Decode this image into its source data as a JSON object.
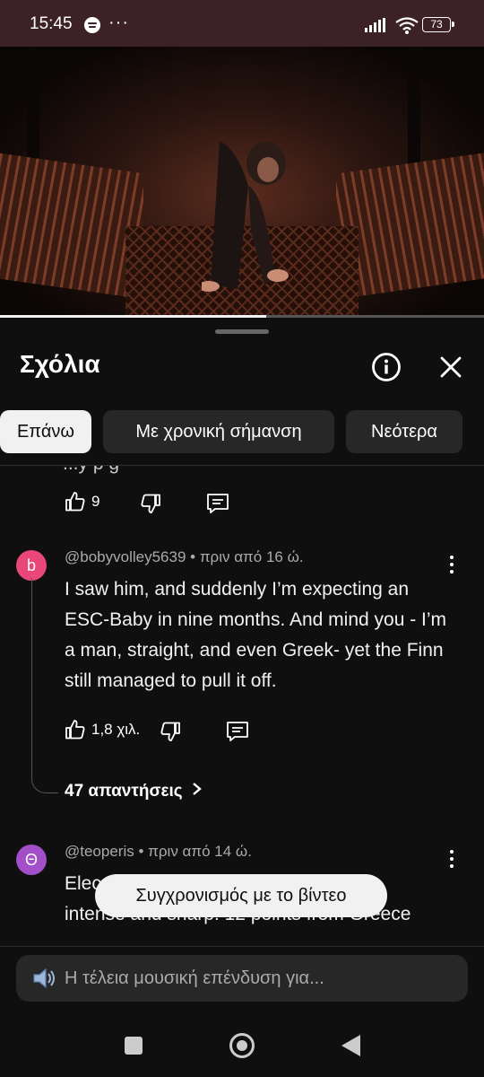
{
  "status_bar": {
    "time": "15:45",
    "notification_dots": "···",
    "battery": "73"
  },
  "video": {
    "progress": 0.55
  },
  "comments_panel": {
    "title": "Σχόλια",
    "chips": [
      "Επάνω",
      "Με χρονική σήμανση",
      "Νεότερα"
    ],
    "active_chip": "Επάνω",
    "cut_comment": {
      "text_fragment": "...y  p           g",
      "likes": "9"
    },
    "comments": [
      {
        "avatar_letter": "b",
        "avatar_color": "#e9467a",
        "author": "@bobyvolley5639",
        "time": "• πριν από 16 ώ.",
        "text": "I saw him, and suddenly I’m expecting an ESC-Baby in nine months. And mind you - I’m a man, straight, and even Greek- yet the Finn still managed to pull it off.",
        "likes": "1,8 χιλ.",
        "replies": "47 απαντήσεις"
      },
      {
        "avatar_letter": "Θ",
        "avatar_color": "#a24fc9",
        "author": "@teoperis",
        "time": "• πριν από 14 ώ.",
        "text_line1": "Elec",
        "text_line2": "intense and sharp! 12 points from Greece"
      }
    ],
    "toast": "Συγχρονισμός με το βίντεο",
    "input_placeholder": "Η τέλεια μουσική επένδυση για..."
  },
  "icons": [
    "spotify-icon",
    "signal-icon",
    "wifi-icon",
    "battery-icon",
    "info-icon",
    "close-icon",
    "thumb-up-icon",
    "thumb-down-icon",
    "reply-icon",
    "kebab-menu-icon",
    "chevron-right-icon",
    "speaker-icon",
    "nav-recents-icon",
    "nav-home-icon",
    "nav-back-icon"
  ]
}
